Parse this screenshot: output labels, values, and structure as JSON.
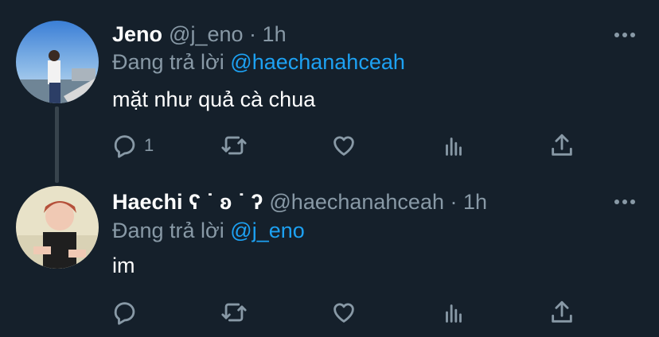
{
  "tweets": [
    {
      "name": "Jeno",
      "handle": "@j_eno",
      "separator": "·",
      "time": "1h",
      "replying_prefix": "Đang trả lời",
      "replying_to": "@haechanahceah",
      "text": "mặt như quả cà chua",
      "reply_count": "1",
      "icons": [
        "reply-icon",
        "retweet-icon",
        "like-icon",
        "analytics-icon",
        "share-icon",
        "more-icon"
      ]
    },
    {
      "name": "Haechi ʕ ˙ ʚ ˙ ʔ",
      "handle": "@haechanahceah",
      "separator": "·",
      "time": "1h",
      "replying_prefix": "Đang trả lời",
      "replying_to": "@j_eno",
      "text": "im",
      "reply_count": "",
      "icons": [
        "reply-icon",
        "retweet-icon",
        "like-icon",
        "analytics-icon",
        "share-icon",
        "more-icon"
      ]
    }
  ],
  "colors": {
    "background": "#15202b",
    "primary_text": "#ffffff",
    "secondary_text": "#8899a6",
    "accent": "#1da1f2",
    "thread_line": "#38444d"
  }
}
